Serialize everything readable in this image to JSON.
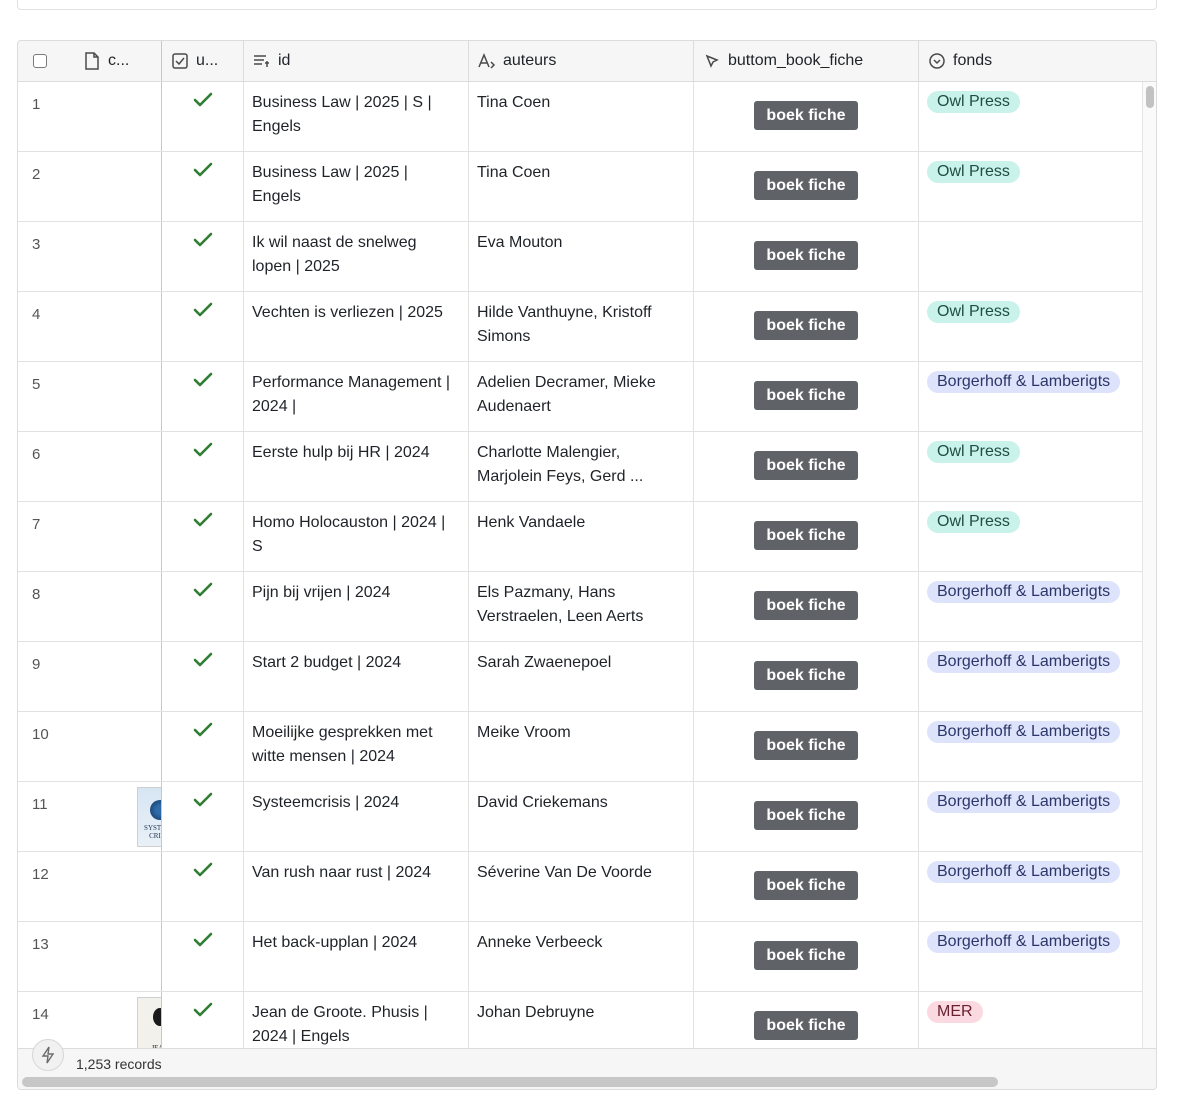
{
  "columns": [
    {
      "key": "select",
      "label": "",
      "icon": "checkbox"
    },
    {
      "key": "cover",
      "label": "c...",
      "icon": "file-icon"
    },
    {
      "key": "u",
      "label": "u...",
      "icon": "checkbox-icon"
    },
    {
      "key": "id",
      "label": "id",
      "icon": "text-lines-icon"
    },
    {
      "key": "auteurs",
      "label": "auteurs",
      "icon": "formula-text-icon"
    },
    {
      "key": "button",
      "label": "buttom_book_fiche",
      "icon": "cursor-click-icon"
    },
    {
      "key": "fonds",
      "label": "fonds",
      "icon": "single-select-icon"
    }
  ],
  "button_label": "boek fiche",
  "rows": [
    {
      "num": "1",
      "id": "Business Law | 2025 | S | Engels",
      "auteurs": "Tina Coen",
      "fonds": "Owl Press",
      "fonds_style": "owl",
      "thumb": ""
    },
    {
      "num": "2",
      "id": "Business Law | 2025 | Engels",
      "auteurs": "Tina Coen",
      "fonds": "Owl Press",
      "fonds_style": "owl",
      "thumb": ""
    },
    {
      "num": "3",
      "id": "Ik wil naast de snelweg lopen  | 2025",
      "auteurs": "Eva Mouton",
      "fonds": "",
      "fonds_style": "",
      "thumb": ""
    },
    {
      "num": "4",
      "id": "Vechten is verliezen | 2025",
      "auteurs": "Hilde  Vanthuyne, Kristoff Simons",
      "fonds": "Owl Press",
      "fonds_style": "owl",
      "thumb": ""
    },
    {
      "num": "5",
      "id": "Performance Management | 2024 |",
      "auteurs": "Adelien Decramer, Mieke Audenaert",
      "fonds": "Borgerhoff & Lamberigts",
      "fonds_style": "borg",
      "thumb": ""
    },
    {
      "num": "6",
      "id": "Eerste hulp bij HR | 2024",
      "auteurs": "Charlotte Malengier, Marjolein Feys, Gerd ...",
      "fonds": "Owl Press",
      "fonds_style": "owl",
      "thumb": ""
    },
    {
      "num": "7",
      "id": "Homo Holocauston | 2024 | S",
      "auteurs": "Henk Vandaele",
      "fonds": "Owl Press",
      "fonds_style": "owl",
      "thumb": ""
    },
    {
      "num": "8",
      "id": "Pijn bij vrijen | 2024",
      "auteurs": "Els Pazmany, Hans Verstraelen, Leen Aerts",
      "fonds": "Borgerhoff & Lamberigts",
      "fonds_style": "borg",
      "thumb": ""
    },
    {
      "num": "9",
      "id": "Start 2 budget | 2024",
      "auteurs": "Sarah Zwaenepoel",
      "fonds": "Borgerhoff & Lamberigts",
      "fonds_style": "borg",
      "thumb": ""
    },
    {
      "num": "10",
      "id": "Moeilijke gesprekken met witte mensen | 2024",
      "auteurs": "Meike Vroom",
      "fonds": "Borgerhoff & Lamberigts",
      "fonds_style": "borg",
      "thumb": ""
    },
    {
      "num": "11",
      "id": "Systeemcrisis | 2024",
      "auteurs": "David Criekemans",
      "fonds": "Borgerhoff & Lamberigts",
      "fonds_style": "borg",
      "thumb": "t1"
    },
    {
      "num": "12",
      "id": "Van rush naar rust | 2024",
      "auteurs": "Séverine Van De Voorde",
      "fonds": "Borgerhoff & Lamberigts",
      "fonds_style": "borg",
      "thumb": ""
    },
    {
      "num": "13",
      "id": "Het back-upplan | 2024",
      "auteurs": "Anneke Verbeeck",
      "fonds": "Borgerhoff & Lamberigts",
      "fonds_style": "borg",
      "thumb": ""
    },
    {
      "num": "14",
      "id": "Jean de Groote. Phusis | 2024 | Engels",
      "auteurs": "Johan  Debruyne",
      "fonds": "MER",
      "fonds_style": "mer",
      "thumb": "t2"
    }
  ],
  "footer": {
    "records": "1,253 records"
  },
  "colors": {
    "check": "#2e7d32",
    "button": "#5f6368",
    "owl_tag": "#c9f2ea",
    "borg_tag": "#dde3fb",
    "mer_tag": "#fbd9e0"
  }
}
